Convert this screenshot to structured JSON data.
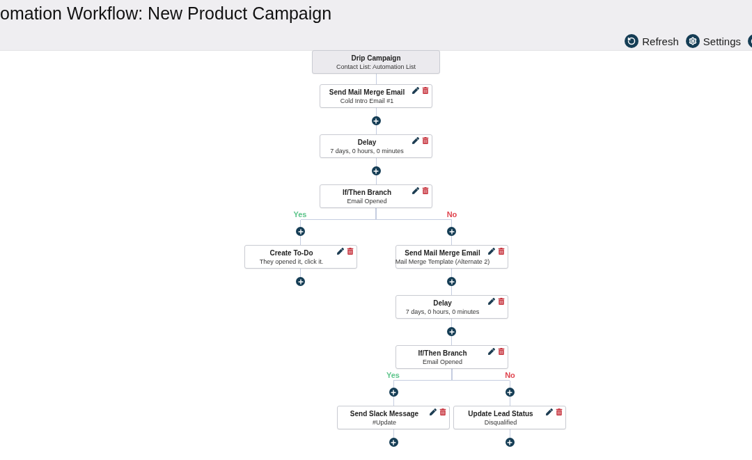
{
  "header": {
    "title": "omation Workflow: New Product Campaign",
    "actions": [
      {
        "kind": "refresh",
        "label": "Refresh"
      },
      {
        "kind": "settings",
        "label": "Settings"
      },
      {
        "kind": "power"
      }
    ]
  },
  "trigger": {
    "title": "Drip Campaign",
    "detail": "Contact List: Automation List"
  },
  "steps": [
    {
      "kind": "action",
      "title": "Send Mail Merge Email",
      "detail": "Cold Intro Email #1"
    },
    {
      "kind": "action",
      "title": "Delay",
      "detail": "7 days, 0 hours, 0 minutes"
    },
    {
      "kind": "branch",
      "title": "If/Then Branch",
      "detail": "Email Opened",
      "branches": [
        {
          "label": "Yes",
          "color": "#5cc48a",
          "steps": [
            {
              "kind": "action",
              "title": "Create To-Do",
              "detail": "They opened it, click it."
            }
          ]
        },
        {
          "label": "No",
          "color": "#e0454f",
          "steps": [
            {
              "kind": "action",
              "title": "Send Mail Merge Email",
              "detail": "Mail Merge Template (Alternate 2)"
            },
            {
              "kind": "action",
              "title": "Delay",
              "detail": "7 days, 0 hours, 0 minutes"
            },
            {
              "kind": "branch",
              "title": "If/Then Branch",
              "detail": "Email Opened",
              "branches": [
                {
                  "label": "Yes",
                  "color": "#5cc48a",
                  "steps": [
                    {
                      "kind": "action",
                      "title": "Send Slack Message",
                      "detail": "#Update"
                    }
                  ]
                },
                {
                  "label": "No",
                  "color": "#e0454f",
                  "steps": [
                    {
                      "kind": "action",
                      "title": "Update Lead Status",
                      "detail": "Disqualified"
                    }
                  ]
                }
              ]
            }
          ]
        }
      ]
    }
  ]
}
